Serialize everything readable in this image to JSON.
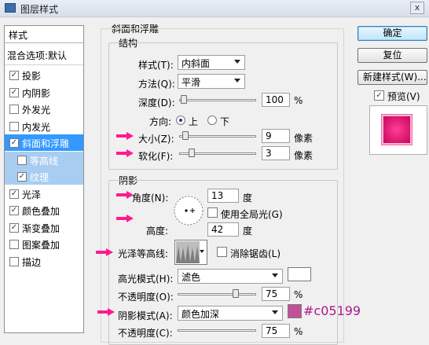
{
  "window": {
    "title": "图层样式",
    "close_glyph": "x"
  },
  "style_list": {
    "header": "样式",
    "blend_item": "混合选项:默认",
    "items": [
      {
        "label": "投影",
        "checked": true,
        "selected": false,
        "sub": false
      },
      {
        "label": "内阴影",
        "checked": true,
        "selected": false,
        "sub": false
      },
      {
        "label": "外发光",
        "checked": false,
        "selected": false,
        "sub": false
      },
      {
        "label": "内发光",
        "checked": false,
        "selected": false,
        "sub": false
      },
      {
        "label": "斜面和浮雕",
        "checked": true,
        "selected": true,
        "sub": false
      },
      {
        "label": "等高线",
        "checked": false,
        "selected": false,
        "sub": true
      },
      {
        "label": "纹理",
        "checked": true,
        "selected": false,
        "sub": true
      },
      {
        "label": "光泽",
        "checked": true,
        "selected": false,
        "sub": false
      },
      {
        "label": "颜色叠加",
        "checked": true,
        "selected": false,
        "sub": false
      },
      {
        "label": "渐变叠加",
        "checked": true,
        "selected": false,
        "sub": false
      },
      {
        "label": "图案叠加",
        "checked": false,
        "selected": false,
        "sub": false
      },
      {
        "label": "描边",
        "checked": false,
        "selected": false,
        "sub": false
      }
    ]
  },
  "bevel": {
    "section_title": "斜面和浮雕",
    "structure_title": "结构",
    "style_label": "样式(T):",
    "style_value": "内斜面",
    "method_label": "方法(Q):",
    "method_value": "平滑",
    "depth_label": "深度(D):",
    "depth_value": "100",
    "depth_unit": "%",
    "depth_level": 0.1,
    "direction_label": "方向:",
    "direction_up": "上",
    "direction_down": "下",
    "direction_selected": "上",
    "size_label": "大小(Z):",
    "size_value": "9",
    "size_unit": "像素",
    "soften_label": "软化(F):",
    "soften_value": "3",
    "soften_unit": "像素"
  },
  "shading": {
    "title": "阴影",
    "angle_label": "角度(N):",
    "angle_value": "13",
    "angle_unit": "度",
    "global_light_label": "使用全局光(G)",
    "global_light_checked": false,
    "altitude_label": "高度:",
    "altitude_value": "42",
    "altitude_unit": "度",
    "gloss_contour_label": "光泽等高线:",
    "anti_alias_label": "消除锯齿(L)",
    "anti_alias_checked": false,
    "highlight_mode_label": "高光模式(H):",
    "highlight_mode_value": "滤色",
    "highlight_color": "#ffffff",
    "highlight_opacity_label": "不透明度(O):",
    "highlight_opacity_value": "75",
    "highlight_opacity_unit": "%",
    "shadow_mode_label": "阴影模式(A):",
    "shadow_mode_value": "颜色加深",
    "shadow_color": "#c05199",
    "shadow_color_note": "#c05199",
    "shadow_opacity_label": "不透明度(C):",
    "shadow_opacity_value": "75",
    "shadow_opacity_unit": "%"
  },
  "buttons": {
    "ok": "确定",
    "reset": "复位",
    "new_style": "新建样式(W)...",
    "preview_label": "预览(V)",
    "preview_checked": true
  },
  "colors": {
    "selected": "#3399ff",
    "arrow": "#ff1a8c",
    "preview": "#e0106f"
  }
}
